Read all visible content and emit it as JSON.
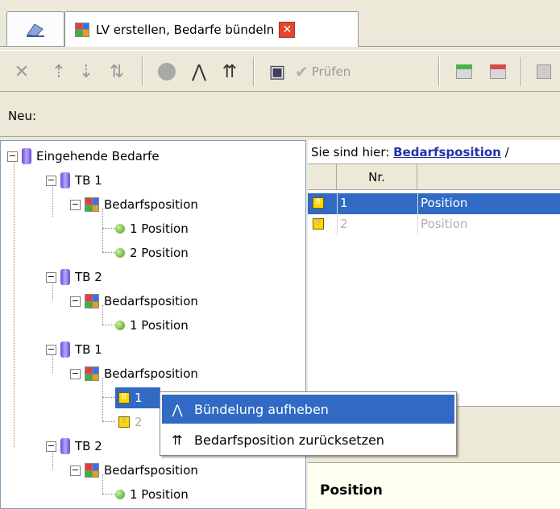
{
  "tabs": {
    "home_icon": "dragon-home-icon",
    "main_title": "LV erstellen, Bedarfe bündeln",
    "close_icon": "close-icon"
  },
  "toolbar": {
    "buttons": [
      {
        "name": "delete",
        "glyph": "✕"
      },
      {
        "name": "move-up",
        "glyph": "⇡"
      },
      {
        "name": "move-down",
        "glyph": "⇣"
      },
      {
        "name": "sort",
        "glyph": "⇅"
      },
      {
        "name": "back",
        "glyph": "◀"
      },
      {
        "name": "bundle",
        "glyph": "⋀"
      },
      {
        "name": "reset",
        "glyph": "⇈"
      },
      {
        "name": "save",
        "glyph": "▣"
      }
    ],
    "check_label": "Prüfen"
  },
  "neu_label": "Neu:",
  "tree": {
    "root": "Eingehende Bedarfe",
    "tb1": "TB 1",
    "tb2": "TB 2",
    "bedarfsposition": "Bedarfsposition",
    "pos1": "1 Position",
    "pos2": "2 Position",
    "sel_item": "1",
    "dim_item": "2"
  },
  "breadcrumb": {
    "prefix": "Sie sind hier:",
    "link": "Bedarfsposition",
    "sep": "/"
  },
  "grid": {
    "headers": [
      "Nr."
    ],
    "rows": [
      {
        "nr": "1",
        "name": "Position",
        "selected": true
      },
      {
        "nr": "2",
        "name": "Position",
        "selected": false
      }
    ]
  },
  "detail": {
    "title": "Position"
  },
  "context_menu": {
    "items": [
      {
        "label": "Bündelung aufheben",
        "icon": "unbundle-icon",
        "highlighted": true
      },
      {
        "label": "Bedarfsposition zurücksetzen",
        "icon": "reset-position-icon",
        "highlighted": false
      }
    ]
  },
  "colors": {
    "selection": "#316ac5",
    "window_bg": "#ece9d8",
    "link": "#2233aa"
  }
}
